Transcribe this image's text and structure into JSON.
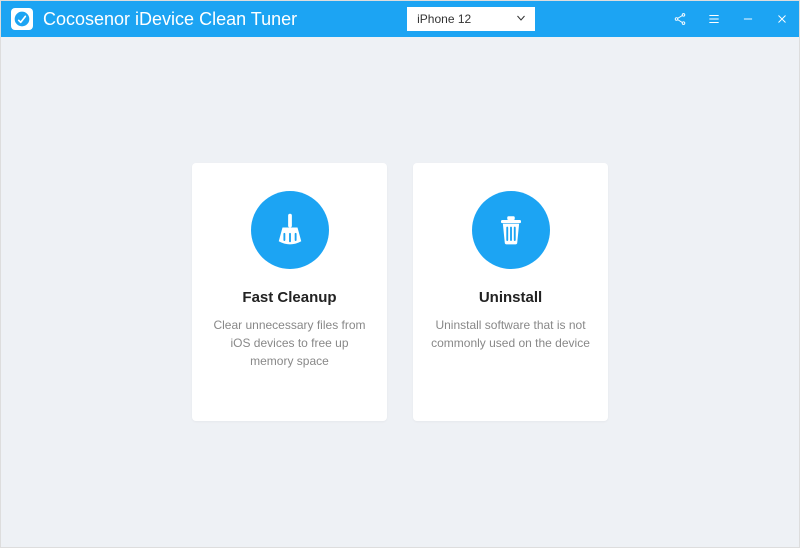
{
  "header": {
    "title": "Cocosenor iDevice Clean Tuner",
    "device_selected": "iPhone 12"
  },
  "cards": {
    "cleanup": {
      "title": "Fast Cleanup",
      "desc": "Clear unnecessary files from iOS devices to free up memory space"
    },
    "uninstall": {
      "title": "Uninstall",
      "desc": "Uninstall software that is not commonly used on the device"
    }
  }
}
